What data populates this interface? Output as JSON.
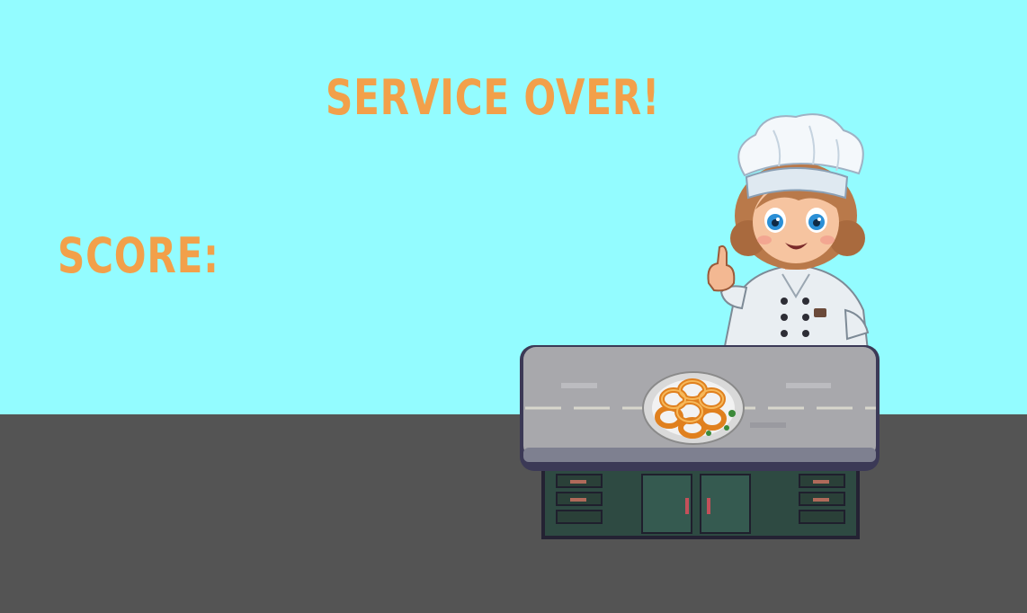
{
  "screen": {
    "title": "SERVICE OVER!",
    "score_label": "SCORE:",
    "score_value": ""
  },
  "sprites": {
    "chef": "chef-character",
    "counter": "kitchen-counter",
    "dish": "onion-rings-plate"
  },
  "colors": {
    "sky": "#93fcff",
    "floor": "#545454",
    "text": "#f2a04a"
  }
}
